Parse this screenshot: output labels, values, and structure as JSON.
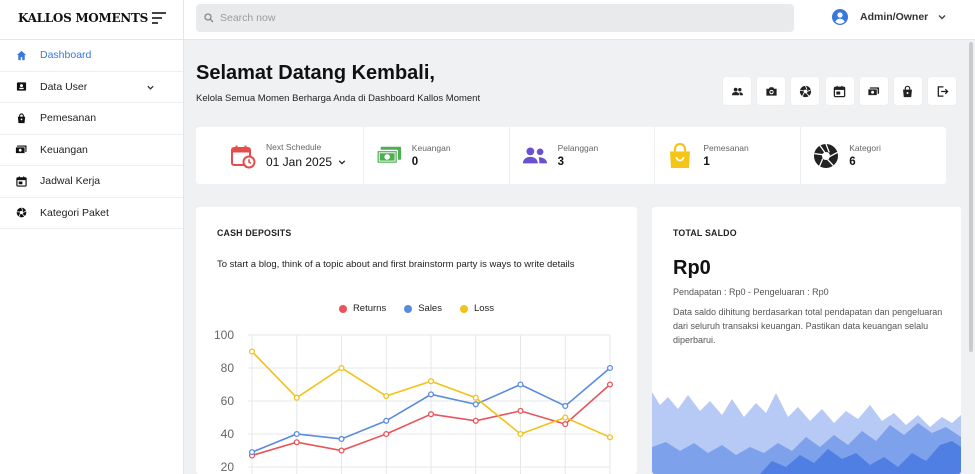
{
  "app": {
    "logo": "KALLOS MOMENTS"
  },
  "search": {
    "placeholder": "Search now"
  },
  "user": {
    "name": "Admin/Owner"
  },
  "sidebar": {
    "items": [
      {
        "label": "Dashboard",
        "icon": "home-icon",
        "active": true
      },
      {
        "label": "Data User",
        "icon": "user-card-icon",
        "has_submenu": true
      },
      {
        "label": "Pemesanan",
        "icon": "bag-icon"
      },
      {
        "label": "Keuangan",
        "icon": "money-icon"
      },
      {
        "label": "Jadwal Kerja",
        "icon": "calendar-icon"
      },
      {
        "label": "Kategori Paket",
        "icon": "aperture-icon"
      }
    ]
  },
  "header": {
    "title": "Selamat Datang Kembali,",
    "subtitle": "Kelola Semua Momen Berharga Anda di Dashboard Kallos Moment",
    "quick_actions": [
      "people-icon",
      "camera-icon",
      "aperture-icon",
      "calendar-icon",
      "money-icon",
      "bag-icon",
      "logout-icon"
    ]
  },
  "stats": {
    "schedule": {
      "label": "Next Schedule",
      "value": "01 Jan 2025"
    },
    "keuangan": {
      "label": "Keuangan",
      "value": "0"
    },
    "pelanggan": {
      "label": "Pelanggan",
      "value": "3"
    },
    "pemesanan": {
      "label": "Pemesanan",
      "value": "1"
    },
    "kategori": {
      "label": "Kategori",
      "value": "6"
    }
  },
  "cash": {
    "title": "CASH DEPOSITS",
    "description": "To start a blog, think of a topic about and first brainstorm party is ways to write details"
  },
  "saldo": {
    "title": "TOTAL SALDO",
    "amount": "Rp0",
    "detail": "Pendapatan : Rp0 - Pengeluaran : Rp0",
    "note": "Data saldo dihitung berdasarkan total pendapatan dan pengeluaran dari seluruh transaksi keuangan. Pastikan data keuangan selalu diperbarui."
  },
  "colors": {
    "accent": "#3a78dc",
    "returns": "#e8545a",
    "sales": "#5b8be0",
    "loss": "#f2c21b"
  },
  "chart_data": {
    "type": "line",
    "title": "",
    "ylim": [
      20,
      100
    ],
    "yticks": [
      20,
      40,
      60,
      80,
      100
    ],
    "x": [
      1,
      2,
      3,
      4,
      5,
      6,
      7,
      8,
      9
    ],
    "legend_position": "top-center",
    "grid": true,
    "series": [
      {
        "name": "Returns",
        "color": "#e8545a",
        "values": [
          27,
          35,
          30,
          40,
          52,
          48,
          54,
          46,
          70
        ]
      },
      {
        "name": "Sales",
        "color": "#5b8be0",
        "values": [
          29,
          40,
          37,
          48,
          64,
          58,
          70,
          57,
          80
        ]
      },
      {
        "name": "Loss",
        "color": "#f2c21b",
        "values": [
          90,
          62,
          80,
          63,
          72,
          62,
          40,
          50,
          38
        ]
      }
    ]
  }
}
